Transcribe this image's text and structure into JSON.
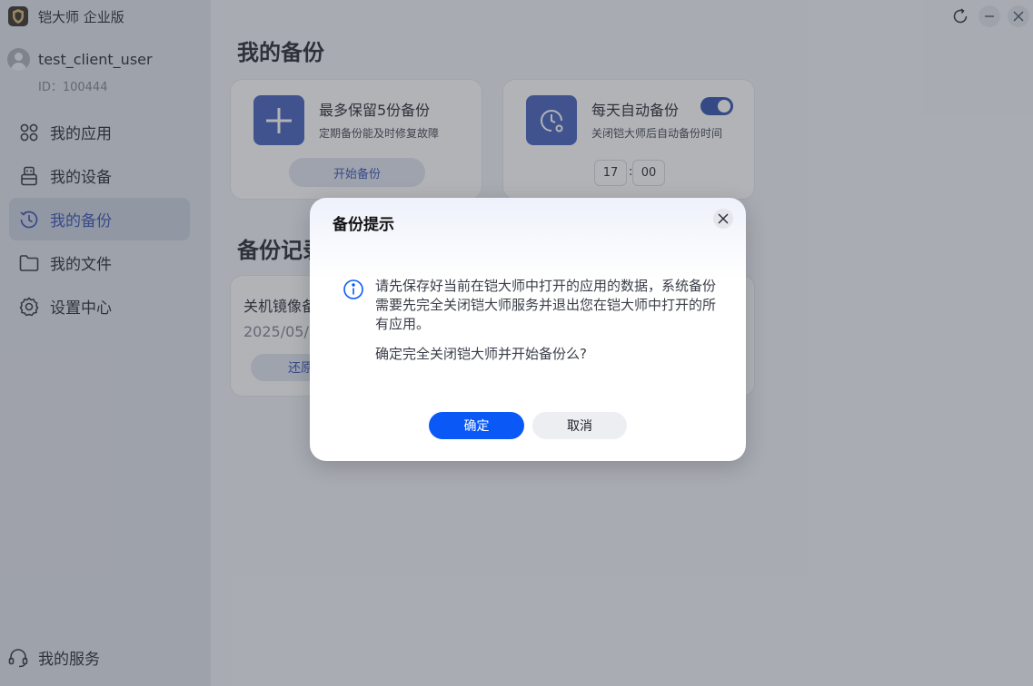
{
  "app": {
    "title": "铠大师 企业版"
  },
  "user": {
    "name": "test_client_user",
    "id": "ID：100444"
  },
  "sidebar": {
    "items": [
      {
        "label": "我的应用",
        "icon": "apps-icon"
      },
      {
        "label": "我的设备",
        "icon": "device-icon"
      },
      {
        "label": "我的备份",
        "icon": "backup-clock-icon",
        "active": true
      },
      {
        "label": "我的文件",
        "icon": "folder-icon"
      },
      {
        "label": "设置中心",
        "icon": "gear-icon"
      }
    ],
    "service": {
      "label": "我的服务",
      "icon": "headset-icon"
    }
  },
  "main": {
    "title": "我的备份",
    "card_manual": {
      "title": "最多保留5份备份",
      "subtitle": "定期备份能及时修复故障",
      "button": "开始备份",
      "icon": "plus-icon"
    },
    "card_auto": {
      "title": "每天自动备份",
      "subtitle": "关闭铠大师后自动备份时间",
      "toggle_on": true,
      "hour": "17",
      "separator": ":",
      "minute": "00",
      "icon": "clock-settings-icon"
    },
    "records_title": "备份记录",
    "record": {
      "title": "关机镜像备份",
      "date": "2025/05/2",
      "restore_button": "还原"
    }
  },
  "dialog": {
    "title": "备份提示",
    "message": "请先保存好当前在铠大师中打开的应用的数据，系统备份需要先完全关闭铠大师服务并退出您在铠大师中打开的所有应用。",
    "question": "确定完全关闭铠大师并开始备份么?",
    "ok": "确定",
    "cancel": "取消"
  },
  "colors": {
    "accent": "#0a59f7",
    "brand_blue": "#3e5bb8",
    "sidebar_bg": "#dfe2ea",
    "overlay": "#464a54"
  }
}
